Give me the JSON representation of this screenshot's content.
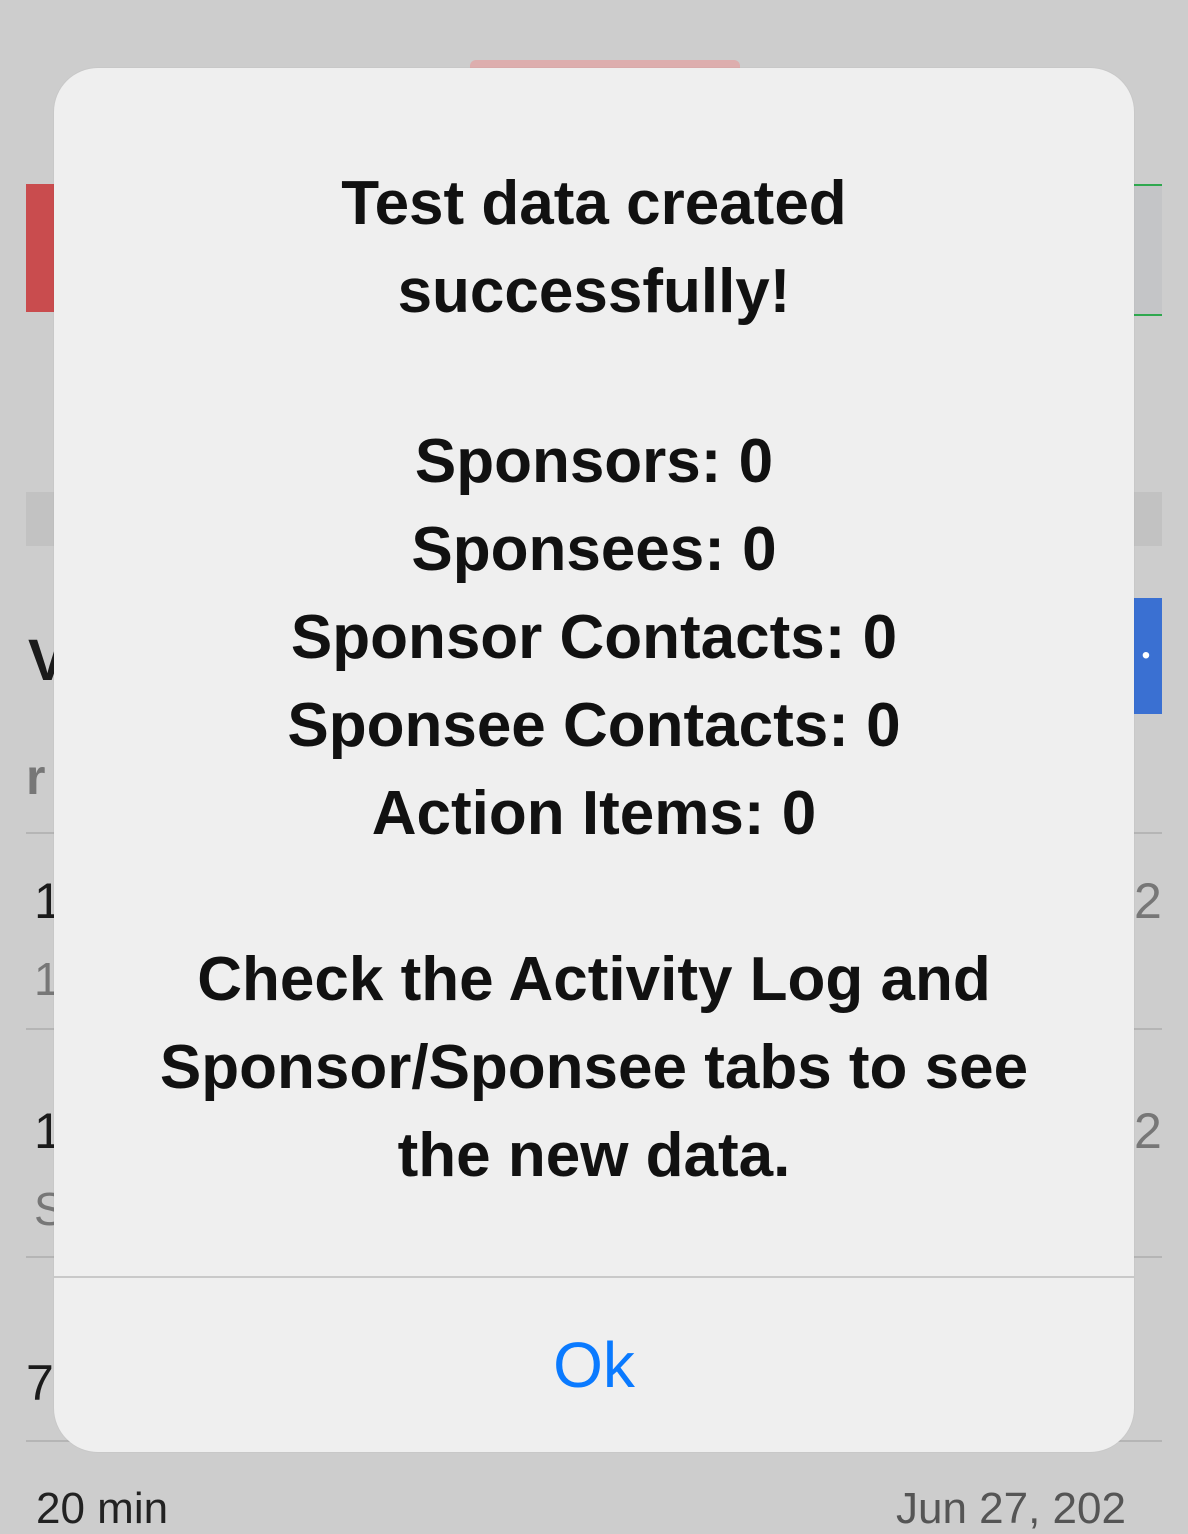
{
  "background": {
    "heading_fragment": "V",
    "subheading_fragment": "r",
    "row1_left": "1",
    "row1_sub": "1",
    "row1_right": "2",
    "row2_left": "1",
    "row2_sub": "S",
    "row2_right": "2",
    "row3_left": "7,",
    "bottom_left": "20 min",
    "bottom_right": "Jun 27, 202"
  },
  "alert": {
    "title_line1": "Test data created",
    "title_line2": "successfully!",
    "counts": [
      "Sponsors: 0",
      "Sponsees: 0",
      "Sponsor Contacts: 0",
      "Sponsee Contacts: 0",
      "Action Items: 0"
    ],
    "note_line1": "Check the Activity Log and",
    "note_line2": "Sponsor/Sponsee tabs to see",
    "note_line3": "the new data.",
    "ok_label": "Ok"
  },
  "colors": {
    "ok_button": "#0a7aff",
    "overlay": "#cdcdcd",
    "alert_background": "#efefef"
  }
}
